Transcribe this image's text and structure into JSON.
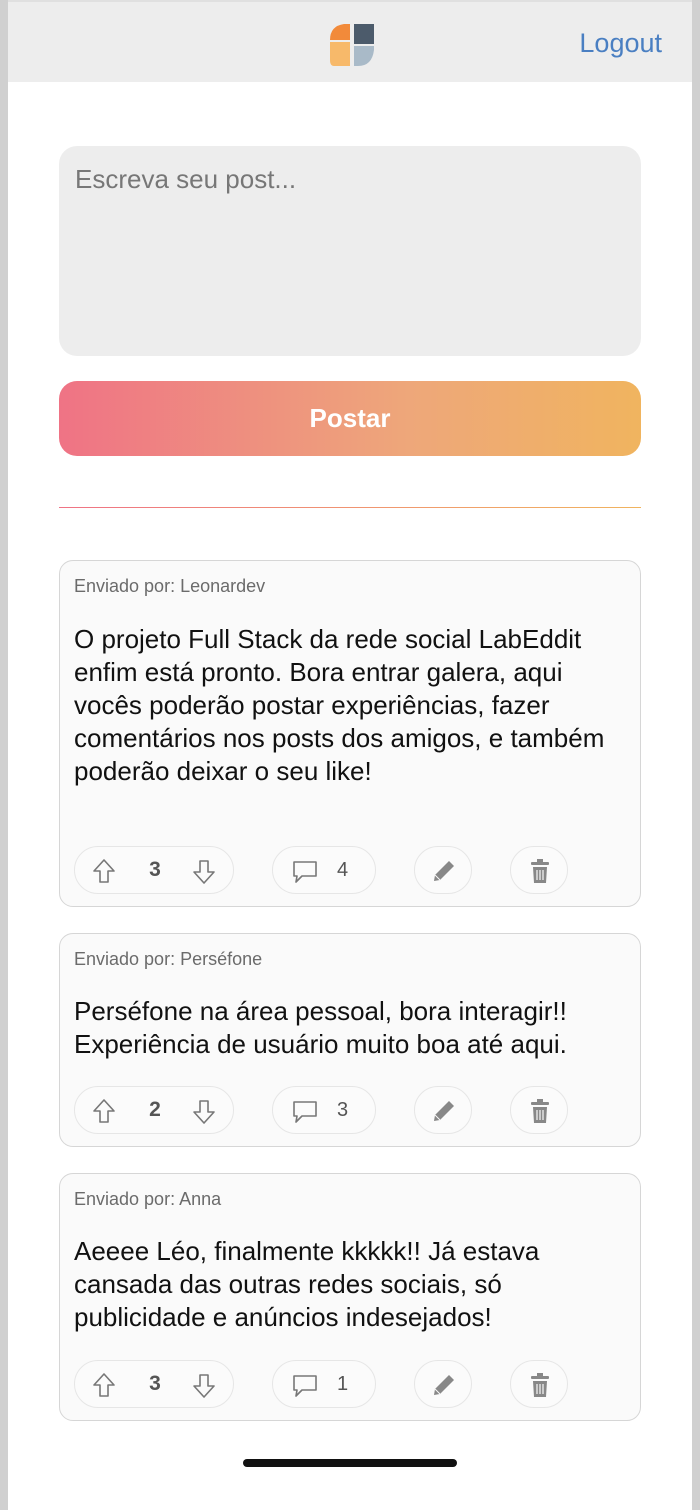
{
  "header": {
    "logout_label": "Logout"
  },
  "composer": {
    "placeholder": "Escreva seu post...",
    "post_button_label": "Postar"
  },
  "posts": [
    {
      "author": "Enviado por: Leonardev",
      "text": "O projeto Full Stack da rede social LabEddit enfim está pronto. Bora entrar galera, aqui vocês poderão postar experiências, fazer comentários nos posts dos amigos, e também poderão deixar o seu like!",
      "votes": "3",
      "comments": "4"
    },
    {
      "author": "Enviado por: Perséfone",
      "text": "Perséfone na área pessoal, bora interagir!! Experiência de usuário muito boa até aqui.",
      "votes": "2",
      "comments": "3"
    },
    {
      "author": "Enviado por: Anna",
      "text": "Aeeee Léo, finalmente kkkkk!! Já estava cansada das outras redes sociais, só publicidade e anúncios indesejados!",
      "votes": "3",
      "comments": "1"
    }
  ],
  "icons": [
    "app-logo-icon",
    "upvote-icon",
    "downvote-icon",
    "comment-icon",
    "pencil-icon",
    "trash-icon"
  ],
  "colors": {
    "accent_pink": "#ef7385",
    "accent_orange": "#f0b45f",
    "link_blue": "#4a7fc2"
  }
}
